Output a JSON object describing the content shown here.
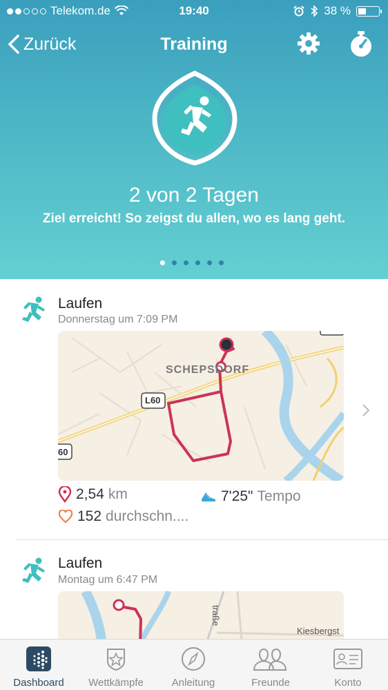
{
  "status_bar": {
    "carrier": "Telekom.de",
    "time": "19:40",
    "battery": "38 %"
  },
  "nav": {
    "back_label": "Zurück",
    "title": "Training"
  },
  "goal": {
    "title": "2 von 2 Tagen",
    "subtitle": "Ziel erreicht! So zeigst du allen, wo es lang geht."
  },
  "pager": {
    "pages": 6,
    "active_index": 0
  },
  "activities": [
    {
      "title": "Laufen",
      "time": "Donnerstag um 7:09 PM",
      "map_labels": {
        "town": "SCHEPSDORF",
        "road1": "L60",
        "road2": "60"
      },
      "distance_value": "2,54",
      "distance_unit": "km",
      "pace_value": "7'25\"",
      "pace_unit": "Tempo",
      "heart_value": "152",
      "heart_unit": "durchschn...."
    },
    {
      "title": "Laufen",
      "time": "Montag um 6:47 PM",
      "map_labels": {
        "street1": "Kiesbergst",
        "street2": "traße"
      }
    }
  ],
  "tabs": [
    {
      "label": "Dashboard",
      "icon": "dashboard-icon",
      "active": true
    },
    {
      "label": "Wettkämpfe",
      "icon": "star-badge-icon",
      "active": false
    },
    {
      "label": "Anleitung",
      "icon": "compass-icon",
      "active": false
    },
    {
      "label": "Freunde",
      "icon": "friends-icon",
      "active": false
    },
    {
      "label": "Konto",
      "icon": "account-card-icon",
      "active": false
    }
  ],
  "colors": {
    "header_top": "#3a9fbd",
    "header_bottom": "#63d0d2",
    "accent_teal": "#3fbfbf",
    "route": "#cc3355",
    "active_tab": "#2c4a63"
  }
}
